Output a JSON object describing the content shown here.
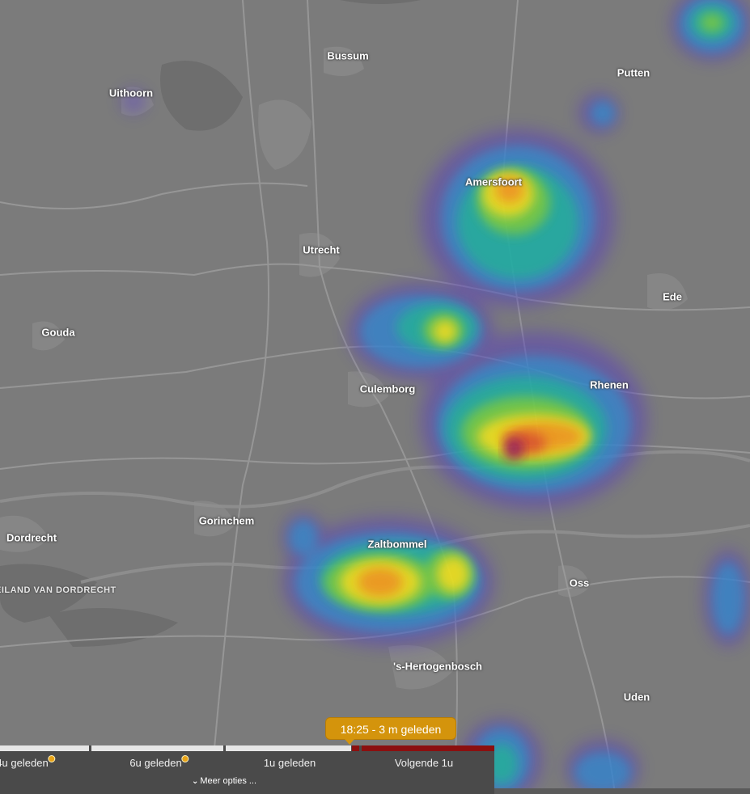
{
  "cities": [
    {
      "name": "Bussum"
    },
    {
      "name": "Putten"
    },
    {
      "name": "Uithoorn"
    },
    {
      "name": "Amersfoort"
    },
    {
      "name": "Utrecht"
    },
    {
      "name": "Ede"
    },
    {
      "name": "Gouda"
    },
    {
      "name": "Rhenen"
    },
    {
      "name": "Culemborg"
    },
    {
      "name": "Gorinchem"
    },
    {
      "name": "Dordrecht"
    },
    {
      "name": "Zaltbommel"
    },
    {
      "name": "Oss"
    },
    {
      "name": "'s-Hertogenbosch"
    },
    {
      "name": "Uden"
    }
  ],
  "region_label": "EILAND VAN DORDRECHT",
  "timeline": {
    "labels": [
      "4u geleden",
      "6u geleden",
      "1u geleden",
      "Volgende 1u"
    ],
    "more_options": "Meer opties ...",
    "current_time_tooltip": "18:25 - 3 m geleden"
  },
  "colors": {
    "map_background": "#7b7b7b",
    "timeline_background": "#4a4a4a",
    "tooltip": "#d4940c",
    "forecast_segment": "#8b0f0f",
    "radar_scale": [
      "#5a3fc0",
      "#2f8fd0",
      "#1fb59a",
      "#7ccf3a",
      "#f2e01e",
      "#f59a1a",
      "#e0502a",
      "#9a1a5a"
    ]
  }
}
